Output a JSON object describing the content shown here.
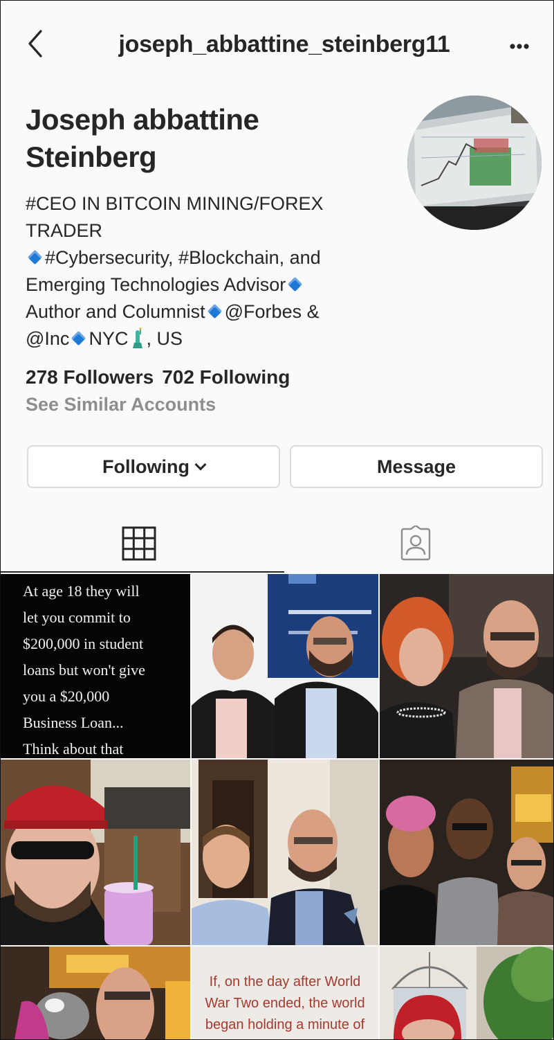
{
  "header": {
    "username": "joseph_abbattine_steinberg11",
    "back_icon": "chevron-left-icon",
    "more_icon": "more-horizontal-icon"
  },
  "profile": {
    "name_line1": "Joseph abbattine",
    "name_line2": "Steinberg",
    "bio": {
      "line1": "#CEO IN BITCOIN MINING/FOREX",
      "line2": "TRADER",
      "line3": "#Cybersecurity, #Blockchain, and",
      "line4": "Emerging Technologies Advisor",
      "line5a": "Author and Columnist",
      "line5b": "@Forbes &",
      "line6a": "@Inc",
      "line6b": "NYC",
      "line6c": ", US"
    },
    "followers": "278 Followers",
    "following": "702 Following",
    "see_similar": "See Similar Accounts"
  },
  "actions": {
    "following_label": "Following",
    "message_label": "Message"
  },
  "tabs": [
    {
      "name": "grid",
      "icon": "grid-icon",
      "active": true
    },
    {
      "name": "tagged",
      "icon": "tagged-person-icon",
      "active": false
    }
  ],
  "posts": {
    "quote1": {
      "line1": "At age 18 they will",
      "line2": "let you commit to",
      "line3": "$200,000 in student",
      "line4": "loans but won't give",
      "line5": "you a $20,000",
      "line6": "Business Loan...",
      "line7": "Think about that"
    },
    "quote2": {
      "line1": "If, on the day after World",
      "line2": "War Two ended, the world",
      "line3": "began holding a minute of"
    }
  },
  "colors": {
    "accent_blue": "#1e78d6",
    "text": "#262626",
    "muted": "#8e8e8e",
    "border": "#dbdbdb"
  }
}
